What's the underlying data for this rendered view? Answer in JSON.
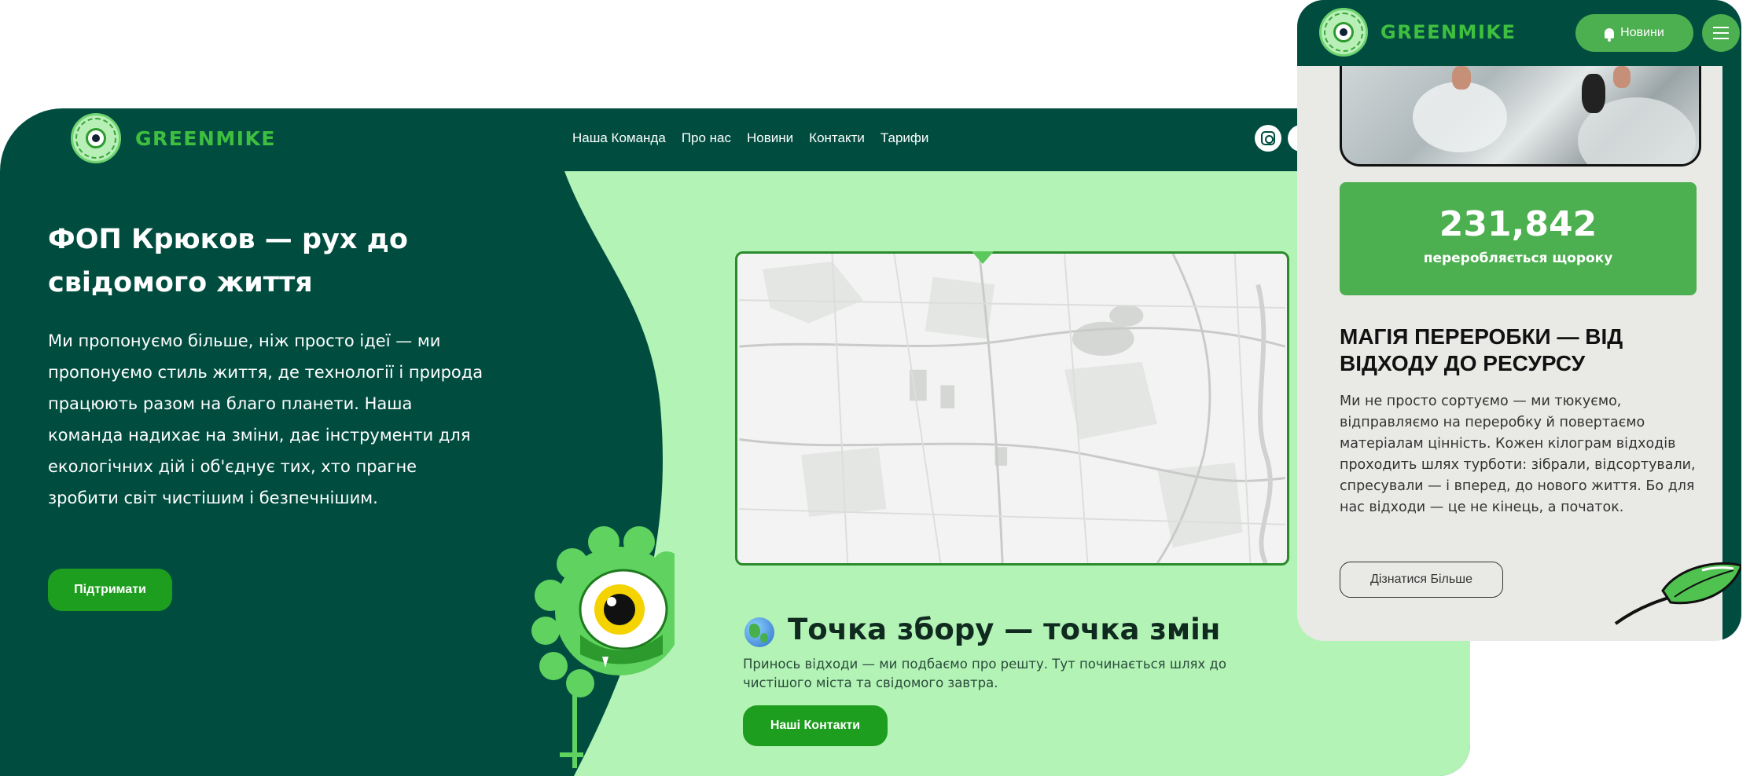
{
  "desktop": {
    "brand": "GREENMIKE",
    "nav": [
      "Наша Команда",
      "Про нас",
      "Новини",
      "Контакти",
      "Тарифи"
    ],
    "hero_title": "ФОП Крюков — рух до свідомого життя",
    "hero_text": "Ми пропонуємо більше, ніж просто ідеї — ми пропонуємо стиль життя, де технології і природа працюють разом на благо планети. Наша команда надихає на зміни, дає інструменти для екологічних дій і об'єднує тих, хто прагне зробити світ чистішим і безпечнішим.",
    "support_button": "Підтримати",
    "point_title": "Точка збору — точка змін",
    "point_text": "Принось відходи — ми подбаємо про решту. Тут починається шлях до чистішого міста та свідомого завтра.",
    "contacts_button": "Наші Контакти"
  },
  "mobile": {
    "brand": "GREENMIKE",
    "news_button": "Новини",
    "stat_value": "231,842",
    "stat_label": "переробляється щороку",
    "section_title": "МАГІЯ ПЕРЕРОБКИ — ВІД ВІДХОДУ ДО РЕСУРСУ",
    "section_text": "Ми не просто сортуємо — ми тюкуємо, відправляємо на переробку й повертаємо матеріалам цінність. Кожен кілограм відходів проходить шлях турботи: зібрали, відсортували, спресували — і вперед, до нового життя. Бо для нас відходи — це не кінець, а початок.",
    "learn_more_button": "Дізнатися Більше"
  },
  "colors": {
    "dark_green": "#004d40",
    "light_green": "#b3f3b6",
    "accent_green": "#4caf50",
    "button_green": "#1e9e1e",
    "brand_text": "#3fbf3f"
  },
  "icons": [
    "logo-badge-icon",
    "instagram-icon",
    "globe-icon",
    "bell-icon",
    "hamburger-icon",
    "leaf-icon",
    "monster-icon",
    "map-pin-icon"
  ]
}
